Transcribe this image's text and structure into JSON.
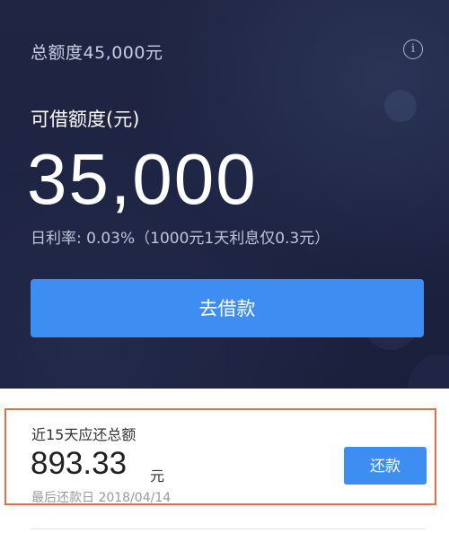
{
  "header": {
    "total_limit_label": "总额度45,000元",
    "info_icon_glyph": "i"
  },
  "credit": {
    "available_label": "可借额度(元)",
    "available_amount": "35,000",
    "rate_text": "日利率: 0.03%（1000元1天利息仅0.3元）",
    "borrow_button_label": "去借款"
  },
  "repayment": {
    "title": "近15天应还总额",
    "amount": "893.33",
    "unit": "元",
    "due_text": "最后还款日 2018/04/14",
    "repay_button_label": "还款"
  },
  "colors": {
    "hero_background": "#1d2340",
    "button_blue": "#3d8df3",
    "highlight_border": "#e56f3e"
  }
}
